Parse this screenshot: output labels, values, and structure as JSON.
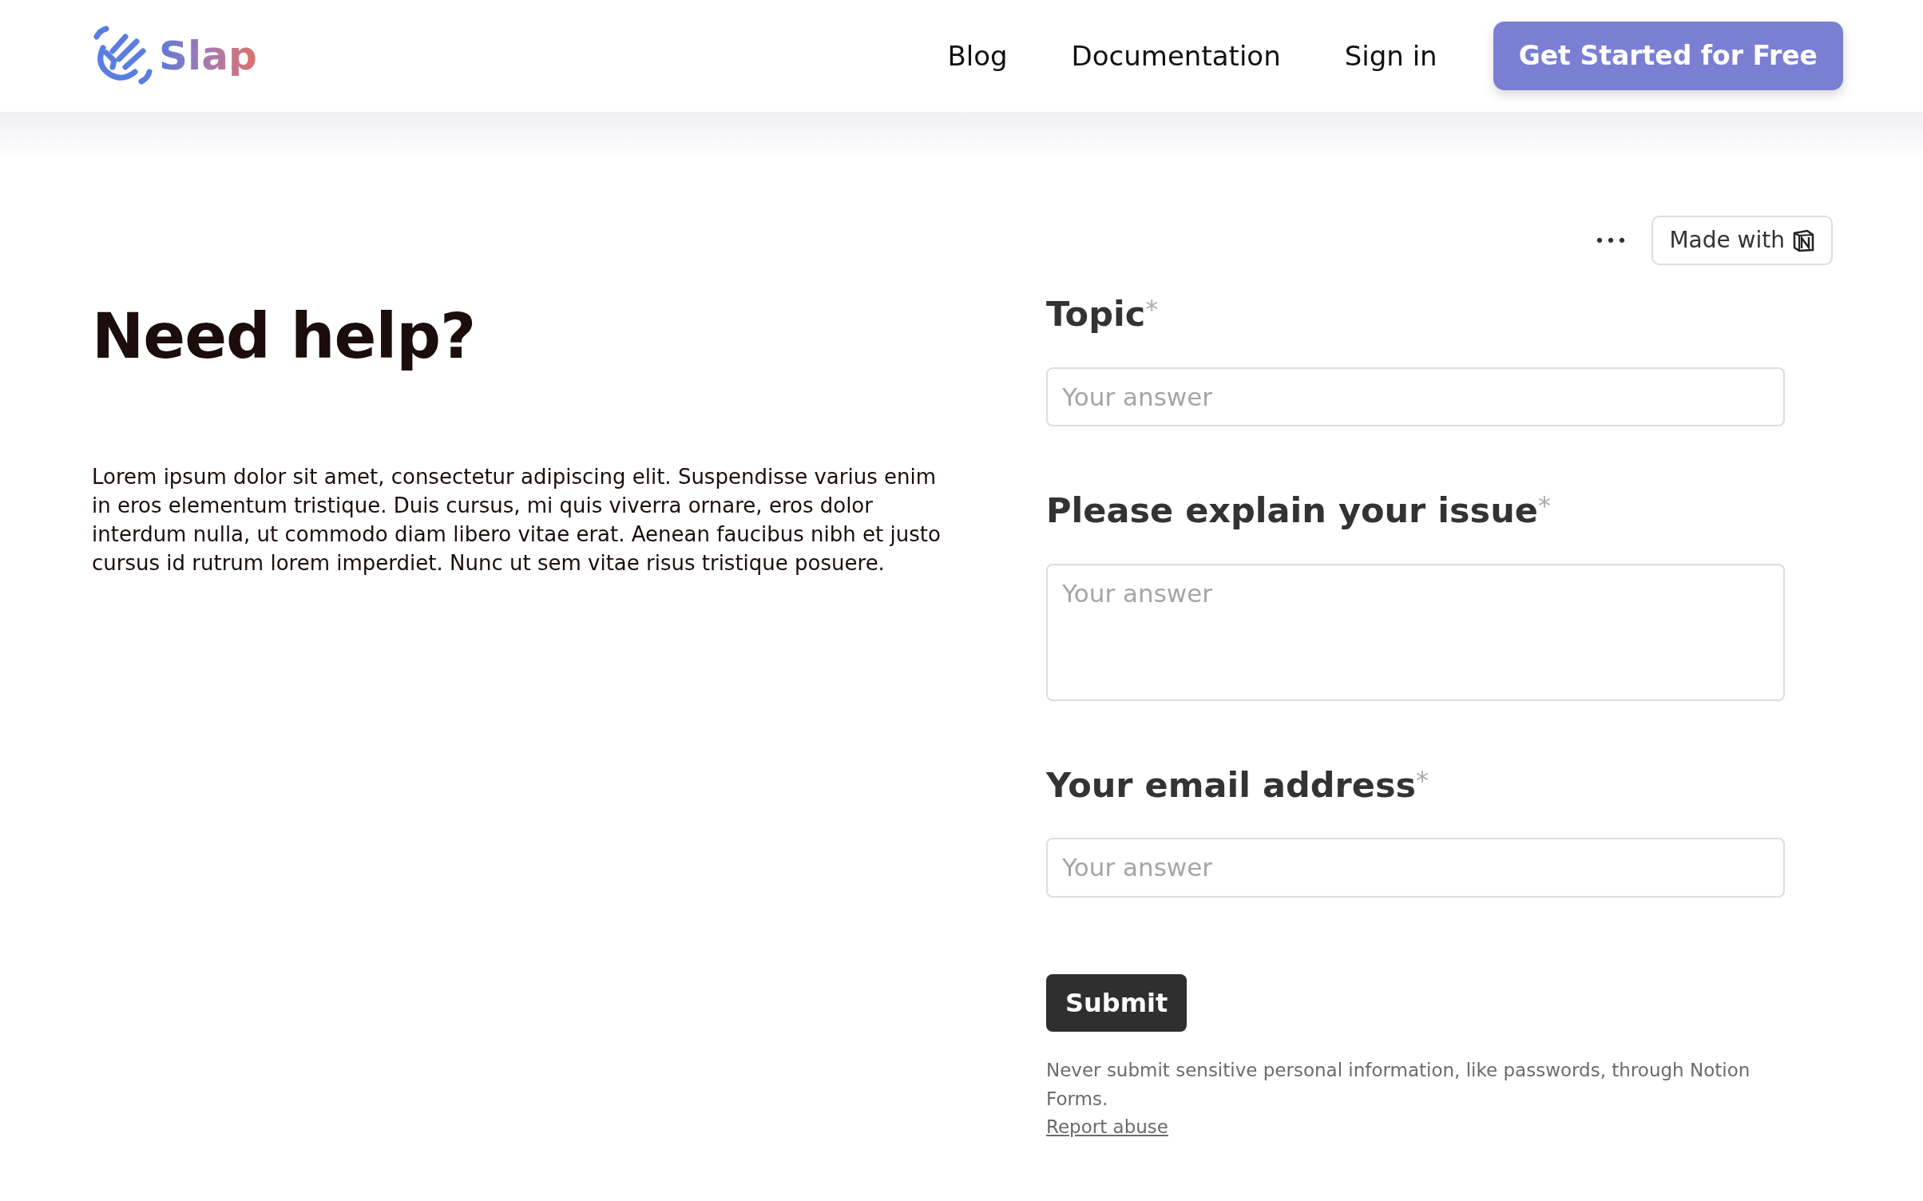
{
  "header": {
    "logo_text": "Slap",
    "nav": [
      {
        "label": "Blog"
      },
      {
        "label": "Documentation"
      },
      {
        "label": "Sign in"
      }
    ],
    "cta": "Get Started for Free"
  },
  "intro": {
    "title": "Need help?",
    "text": "Lorem ipsum dolor sit amet, consectetur adipiscing elit. Suspendisse varius enim in eros elementum tristique. Duis cursus, mi quis viverra ornare, eros dolor interdum nulla, ut commodo diam libero vitae erat. Aenean faucibus nibh et justo cursus id rutrum lorem imperdiet. Nunc ut sem vitae risus tristique posuere."
  },
  "form": {
    "more": "•••",
    "made_with": "Made with",
    "fields": [
      {
        "label": "Topic",
        "required_mark": "*",
        "placeholder": "Your answer",
        "kind": "input"
      },
      {
        "label": "Please explain your issue",
        "required_mark": "*",
        "placeholder": "Your answer",
        "kind": "textarea"
      },
      {
        "label": "Your email address",
        "required_mark": "*",
        "placeholder": "Your answer",
        "kind": "input"
      }
    ],
    "submit": "Submit",
    "notice": "Never submit sensitive personal information, like passwords, through Notion Forms.",
    "report": "Report abuse"
  }
}
